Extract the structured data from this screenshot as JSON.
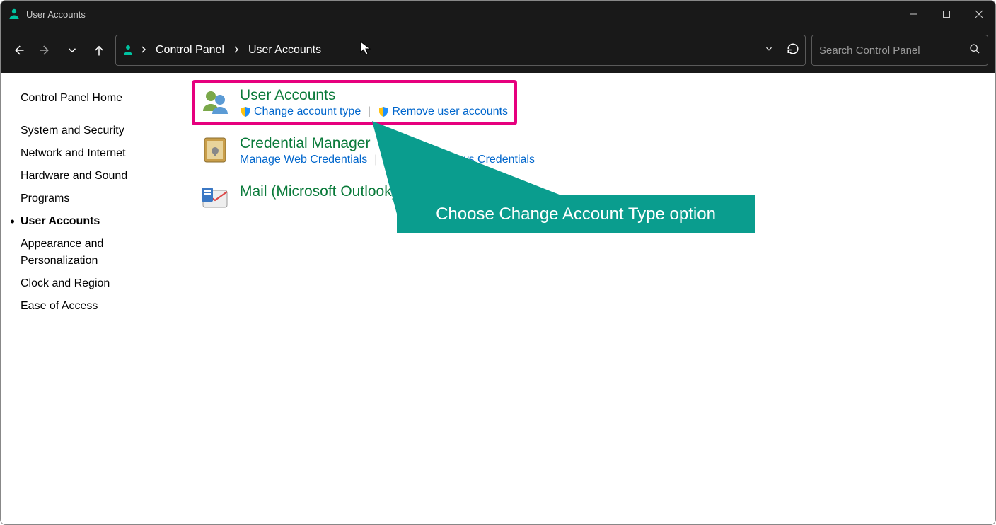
{
  "window": {
    "title": "User Accounts"
  },
  "breadcrumb": {
    "items": [
      "Control Panel",
      "User Accounts"
    ]
  },
  "search": {
    "placeholder": "Search Control Panel"
  },
  "sidebar": {
    "home": "Control Panel Home",
    "items": [
      "System and Security",
      "Network and Internet",
      "Hardware and Sound",
      "Programs",
      "User Accounts",
      "Appearance and Personalization",
      "Clock and Region",
      "Ease of Access"
    ],
    "active_index": 4
  },
  "categories": [
    {
      "title": "User Accounts",
      "links": [
        {
          "label": "Change account type",
          "shield": true
        },
        {
          "label": "Remove user accounts",
          "shield": true
        }
      ],
      "highlight": true
    },
    {
      "title": "Credential Manager",
      "links": [
        {
          "label": "Manage Web Credentials",
          "shield": false
        },
        {
          "label": "Manage Windows Credentials",
          "shield": false
        }
      ],
      "highlight": false
    },
    {
      "title": "Mail (Microsoft Outlook)",
      "links": [],
      "highlight": false
    }
  ],
  "callout": {
    "text": "Choose Change Account Type option"
  }
}
